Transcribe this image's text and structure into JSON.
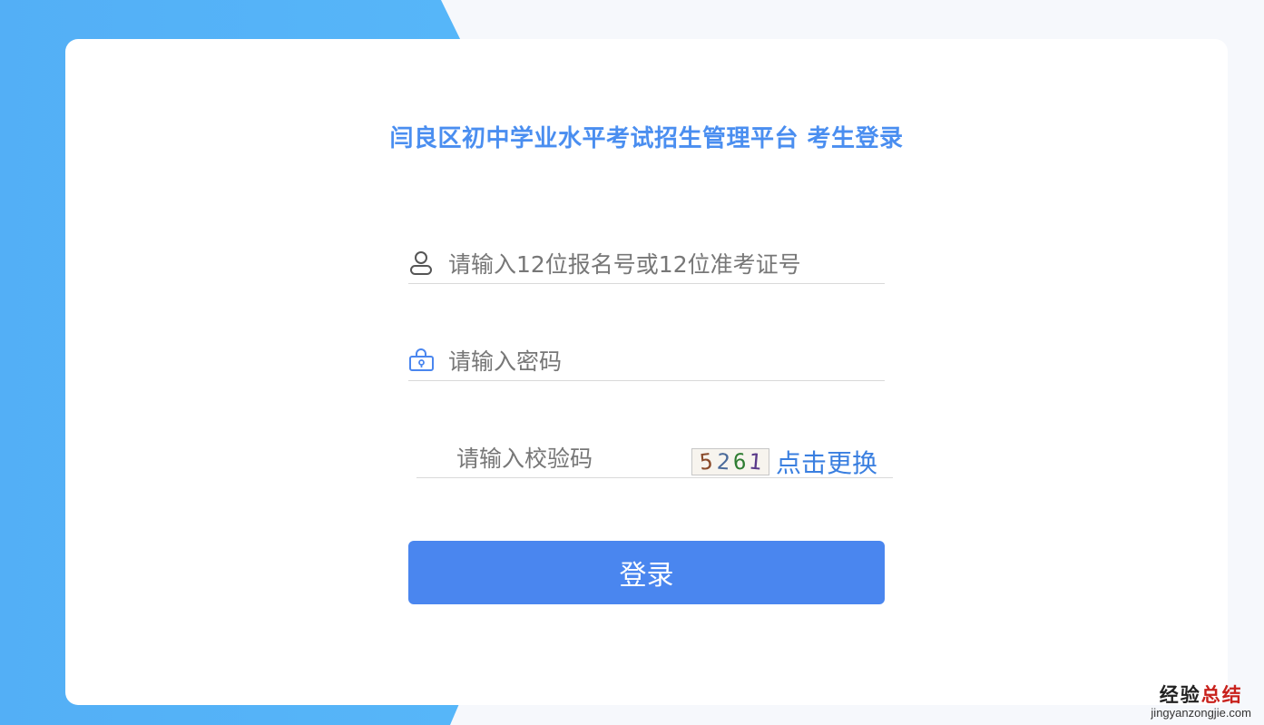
{
  "page": {
    "title": "闫良区初中学业水平考试招生管理平台 考生登录"
  },
  "form": {
    "username_placeholder": "请输入12位报名号或12位准考证号",
    "username_value": "",
    "password_placeholder": "请输入密码",
    "password_value": "",
    "captcha_placeholder": "请输入校验码",
    "captcha_value": "",
    "captcha_text": "5261",
    "captcha_chars": [
      {
        "char": "5",
        "color": "#8a4a2a"
      },
      {
        "char": "2",
        "color": "#4a6a9a"
      },
      {
        "char": "6",
        "color": "#2e7d32"
      },
      {
        "char": "1",
        "color": "#5a3a8a"
      }
    ],
    "refresh_label": "点击更换",
    "login_label": "登录"
  },
  "icons": {
    "user": "user-icon",
    "lock": "lock-icon"
  },
  "colors": {
    "accent": "#4a8ef0",
    "button": "#4a86ef",
    "link": "#3a7fe0",
    "background_left": "#53aff6",
    "background_right": "#f6f8fc"
  },
  "watermark": {
    "brand_prefix": "经验",
    "brand_suffix": "总结",
    "domain": "jingyanzongjie.com"
  }
}
